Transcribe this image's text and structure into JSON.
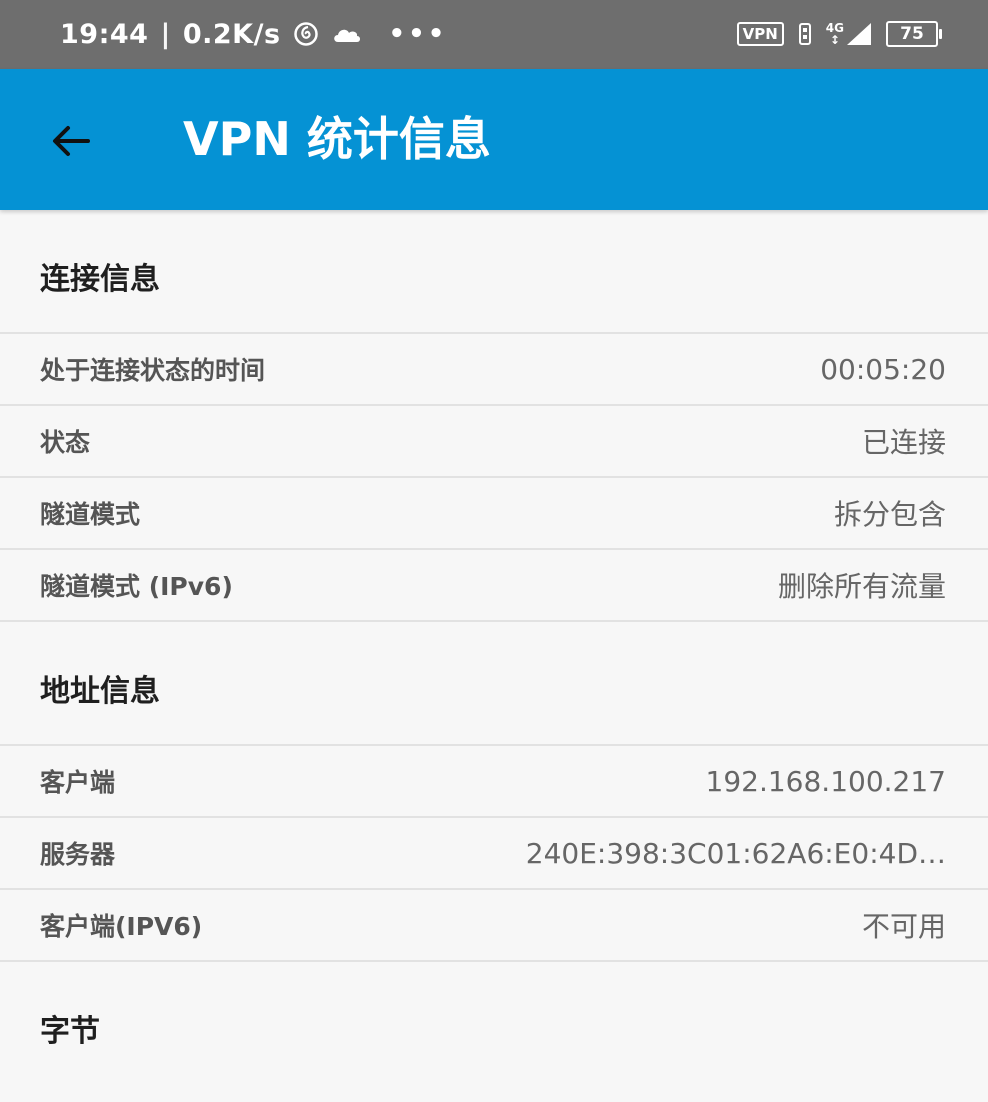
{
  "status_bar": {
    "time": "19:44",
    "net_speed": "0.2K/s",
    "overflow": "•••",
    "vpn_badge": "VPN",
    "network_type": "4G",
    "battery": "75"
  },
  "app_bar": {
    "title": "VPN 统计信息"
  },
  "sections": [
    {
      "header": "连接信息",
      "rows": [
        {
          "label": "处于连接状态的时间",
          "value": "00:05:20"
        },
        {
          "label": "状态",
          "value": "已连接"
        },
        {
          "label": "隧道模式",
          "value": "拆分包含"
        },
        {
          "label": "隧道模式 (IPv6)",
          "value": "删除所有流量"
        }
      ]
    },
    {
      "header": "地址信息",
      "rows": [
        {
          "label": "客户端",
          "value": "192.168.100.217"
        },
        {
          "label": "服务器",
          "value": "240E:398:3C01:62A6:E0:4D…"
        },
        {
          "label": "客户端(IPV6)",
          "value": "不可用"
        }
      ]
    },
    {
      "header": "字节"
    }
  ]
}
